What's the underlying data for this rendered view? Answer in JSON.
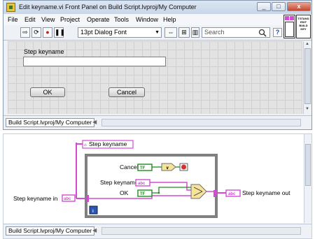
{
  "front_panel": {
    "title": "Edit keyname.vi Front Panel on Build Script.lvproj/My Computer",
    "menu": [
      "File",
      "Edit",
      "View",
      "Project",
      "Operate",
      "Tools",
      "Window",
      "Help"
    ],
    "toolbar": {
      "font": "13pt Dialog Font",
      "search_placeholder": "Search",
      "help": "?"
    },
    "vi_icon_text": [
      "TSTAND",
      "EDIT",
      "BUILD",
      "KEY"
    ],
    "controls": {
      "step_keyname_label": "Step keyname",
      "step_keyname_value": "",
      "ok_label": "OK",
      "cancel_label": "Cancel"
    },
    "status_project": "Build Script.lvproj/My Computer"
  },
  "block_diagram": {
    "terminals": {
      "step_keyname_in": "Step keyname in",
      "step_keyname_ref": "Step keyname",
      "cancel": "Cancel",
      "step_keyname": "Step keyname",
      "ok": "OK",
      "step_keyname_out": "Step keyname out",
      "tf": "TF",
      "abc": "abc",
      "or_glyph": "∨",
      "iteration": "i"
    },
    "status_project": "Build Script.lvproj/My Computer"
  },
  "colors": {
    "string_wire": "#d24cd2",
    "boolean_wire": "#1e8c1e",
    "loop_frame": "#808080",
    "stop": "#d62f2f"
  }
}
